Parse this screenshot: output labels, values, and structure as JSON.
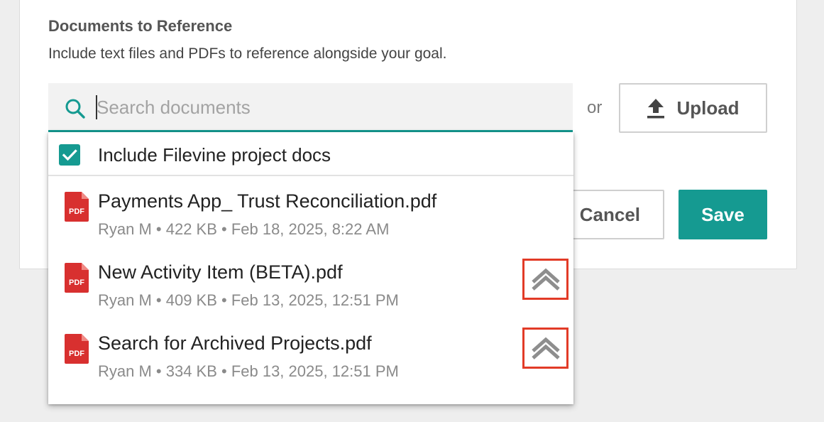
{
  "section": {
    "title": "Documents to Reference",
    "description": "Include text files and PDFs to reference alongside your goal."
  },
  "search": {
    "placeholder": "Search documents",
    "value": ""
  },
  "or_text": "or",
  "upload_label": "Upload",
  "actions": {
    "cancel_label": "Cancel",
    "save_label": "Save"
  },
  "include_option": {
    "label": "Include Filevine project docs",
    "checked": true
  },
  "pdf_icon_text": "PDF",
  "documents": [
    {
      "name": "Payments App_ Trust Reconciliation.pdf",
      "meta": "Ryan M • 422 KB • Feb 18, 2025, 8:22 AM",
      "has_collapse_button": false
    },
    {
      "name": "New Activity Item (BETA).pdf",
      "meta": "Ryan M • 409 KB • Feb 13, 2025, 12:51 PM",
      "has_collapse_button": true
    },
    {
      "name": "Search for Archived Projects.pdf",
      "meta": "Ryan M • 334 KB • Feb 13, 2025, 12:51 PM",
      "has_collapse_button": true
    }
  ],
  "colors": {
    "accent": "#159a91",
    "pdf_red": "#d8302f",
    "highlight_red": "#e23b27",
    "page_bg": "#eeeeee"
  }
}
